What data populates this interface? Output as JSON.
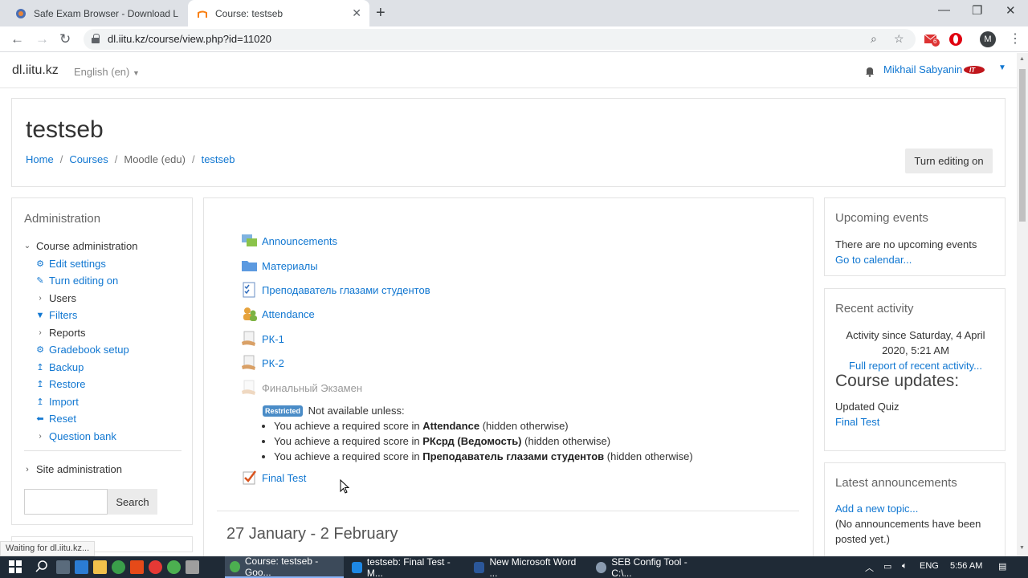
{
  "browser": {
    "tabs": [
      {
        "title": "Safe Exam Browser - Download L",
        "active": false
      },
      {
        "title": "Course: testseb",
        "active": true
      }
    ],
    "url": "dl.iitu.kz/course/view.php?id=11020",
    "profile_initial": "M",
    "mail_badge": "6",
    "status_text": "Waiting for dl.iitu.kz..."
  },
  "navbar": {
    "brand": "dl.iitu.kz",
    "language": "English (en)",
    "user_name": "Mikhail Sabyanin"
  },
  "header": {
    "course_title": "testseb",
    "breadcrumb": [
      "Home",
      "Courses",
      "Moodle (edu)",
      "testseb"
    ],
    "edit_button": "Turn editing on"
  },
  "admin": {
    "title": "Administration",
    "course_admin": "Course administration",
    "items": [
      {
        "label": "Edit settings",
        "icon": "gear-icon"
      },
      {
        "label": "Turn editing on",
        "icon": "pencil-icon"
      },
      {
        "label": "Users",
        "icon": "chevron-right-icon"
      },
      {
        "label": "Filters",
        "icon": "filter-icon"
      },
      {
        "label": "Reports",
        "icon": "chevron-right-icon"
      },
      {
        "label": "Gradebook setup",
        "icon": "gear-icon"
      },
      {
        "label": "Backup",
        "icon": "upload-icon"
      },
      {
        "label": "Restore",
        "icon": "upload-icon"
      },
      {
        "label": "Import",
        "icon": "upload-icon"
      },
      {
        "label": "Reset",
        "icon": "arrow-left-icon"
      },
      {
        "label": "Question bank",
        "icon": "chevron-right-icon"
      }
    ],
    "site_admin": "Site administration",
    "search_button": "Search"
  },
  "course": {
    "activities": [
      {
        "label": "Announcements",
        "icon": "forum-icon"
      },
      {
        "label": "Материалы",
        "icon": "folder-icon"
      },
      {
        "label": "Преподаватель глазами студентов",
        "icon": "feedback-icon"
      },
      {
        "label": "Attendance",
        "icon": "attendance-icon"
      },
      {
        "label": "РК-1",
        "icon": "assignment-icon"
      },
      {
        "label": "РК-2",
        "icon": "assignment-icon"
      },
      {
        "label": "Финальный Экзамен",
        "icon": "assignment-icon"
      }
    ],
    "restriction": {
      "badge": "Restricted",
      "intro": "Not available unless:",
      "prefix": "You achieve a required score in",
      "suffix": "(hidden otherwise)",
      "items": [
        "Attendance",
        "РКсрд (Ведомость)",
        "Преподаватель глазами студентов"
      ]
    },
    "final_test": "Final Test",
    "section_title": "27 January - 2 February"
  },
  "upcoming": {
    "title": "Upcoming events",
    "text": "There are no upcoming events",
    "link": "Go to calendar..."
  },
  "recent": {
    "title": "Recent activity",
    "since_line1": "Activity since Saturday, 4 April",
    "since_line2": "2020, 5:21 AM",
    "full_report": "Full report of recent activity...",
    "updates_heading": "Course updates:",
    "update_type": "Updated Quiz",
    "update_link": "Final Test"
  },
  "announcements": {
    "title": "Latest announcements",
    "add_topic": "Add a new topic...",
    "none_line1": "(No announcements have been",
    "none_line2": "posted yet.)"
  },
  "taskbar": {
    "items": [
      {
        "label": "Course: testseb - Goo...",
        "active": true
      },
      {
        "label": "testseb: Final Test - M...",
        "active": false
      },
      {
        "label": "New Microsoft Word ...",
        "active": false
      },
      {
        "label": "SEB Config Tool - C:\\...",
        "active": false
      }
    ],
    "language": "ENG",
    "time": "5:56 AM"
  }
}
